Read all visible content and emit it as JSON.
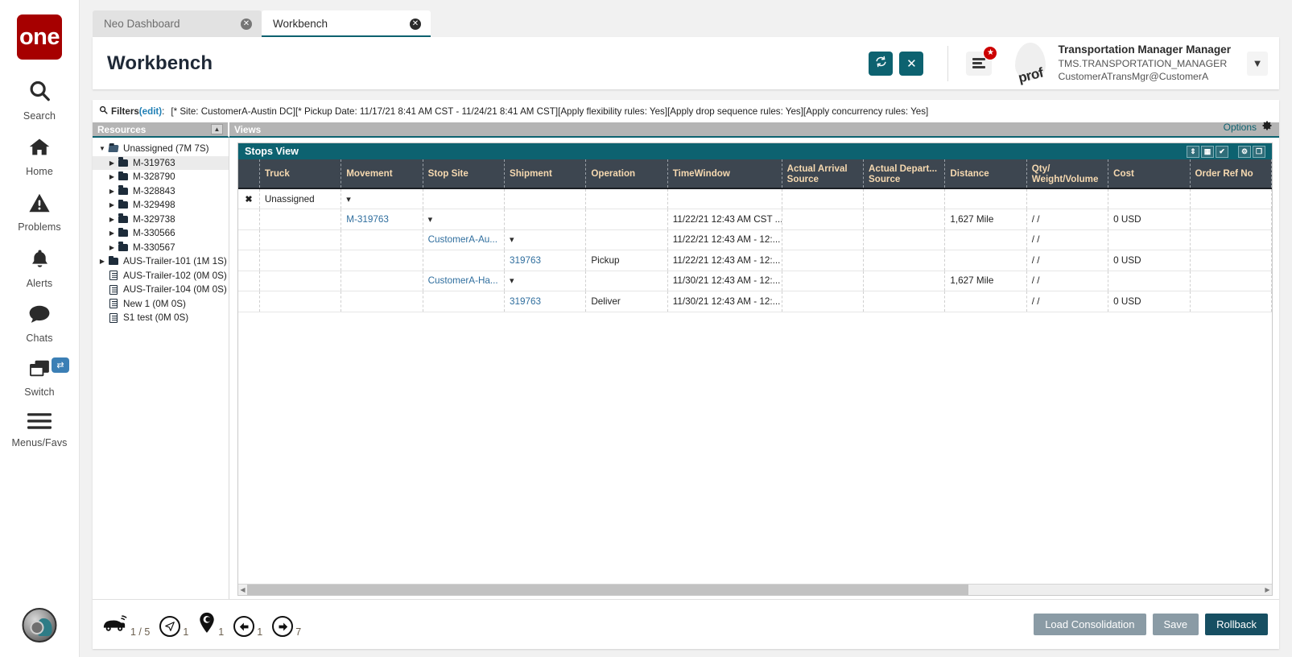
{
  "brand": {
    "logo_text": "one"
  },
  "rail": {
    "items": [
      {
        "label": "Search",
        "icon": "search-icon"
      },
      {
        "label": "Home",
        "icon": "home-icon"
      },
      {
        "label": "Problems",
        "icon": "warning-triangle-icon"
      },
      {
        "label": "Alerts",
        "icon": "bell-icon"
      },
      {
        "label": "Chats",
        "icon": "chat-bubble-icon"
      },
      {
        "label": "Switch",
        "icon": "windows-stack-icon",
        "badge_icon": "swap-arrows-icon"
      },
      {
        "label": "Menus/Favs",
        "icon": "hamburger-icon"
      }
    ]
  },
  "tabs": [
    {
      "label": "Neo Dashboard",
      "active": false
    },
    {
      "label": "Workbench",
      "active": true
    }
  ],
  "header": {
    "title": "Workbench",
    "refresh_icon": "refresh-icon",
    "close_icon": "close-x-icon",
    "menu_icon": "hamburger-menu-icon",
    "notification_badge": "★",
    "avatar_text": "prof",
    "user_name": "Transportation Manager Manager",
    "user_role": "TMS.TRANSPORTATION_MANAGER",
    "user_account": "CustomerATransMgr@CustomerA",
    "caret_icon": "chevron-down-icon"
  },
  "filters": {
    "icon": "search-icon",
    "label": "Filters",
    "edit_link": "(edit)",
    "colon": ":",
    "value": "[* Site: CustomerA-Austin DC][* Pickup Date: 11/17/21 8:41 AM CST - 11/24/21 8:41 AM CST][Apply flexibility rules: Yes][Apply drop sequence rules: Yes][Apply concurrency rules: Yes]"
  },
  "panels": {
    "resources_title": "Resources",
    "views_title": "Views",
    "collapse_icon": "chevron-up-icon",
    "options_label": "Options",
    "options_icon": "gear-icon"
  },
  "tree": [
    {
      "label": "Unassigned (7M 7S)",
      "indent": 0,
      "arrow": "▼",
      "icon": "folder-open-icon",
      "selected": false
    },
    {
      "label": "M-319763",
      "indent": 1,
      "arrow": "▶",
      "icon": "folder-icon",
      "selected": true
    },
    {
      "label": "M-328790",
      "indent": 1,
      "arrow": "▶",
      "icon": "folder-icon",
      "selected": false
    },
    {
      "label": "M-328843",
      "indent": 1,
      "arrow": "▶",
      "icon": "folder-icon",
      "selected": false
    },
    {
      "label": "M-329498",
      "indent": 1,
      "arrow": "▶",
      "icon": "folder-icon",
      "selected": false
    },
    {
      "label": "M-329738",
      "indent": 1,
      "arrow": "▶",
      "icon": "folder-icon",
      "selected": false
    },
    {
      "label": "M-330566",
      "indent": 1,
      "arrow": "▶",
      "icon": "folder-icon",
      "selected": false
    },
    {
      "label": "M-330567",
      "indent": 1,
      "arrow": "▶",
      "icon": "folder-icon",
      "selected": false
    },
    {
      "label": "AUS-Trailer-101 (1M 1S)",
      "indent": 0,
      "arrow": "▶",
      "icon": "folder-icon",
      "selected": false
    },
    {
      "label": "AUS-Trailer-102 (0M 0S)",
      "indent": 0,
      "arrow": "",
      "icon": "document-icon",
      "selected": false
    },
    {
      "label": "AUS-Trailer-104 (0M 0S)",
      "indent": 0,
      "arrow": "",
      "icon": "document-icon",
      "selected": false
    },
    {
      "label": "New 1 (0M 0S)",
      "indent": 0,
      "arrow": "",
      "icon": "document-icon",
      "selected": false
    },
    {
      "label": "S1 test (0M 0S)",
      "indent": 0,
      "arrow": "",
      "icon": "document-icon",
      "selected": false
    }
  ],
  "grid": {
    "title": "Stops View",
    "tools": [
      {
        "icon": "expand-collapse-icon",
        "glyph": "⇕"
      },
      {
        "icon": "table-grid-icon",
        "glyph": "▦"
      },
      {
        "icon": "checkmark-icon",
        "glyph": "✔"
      },
      {
        "icon": "gear-icon",
        "glyph": "⚙"
      },
      {
        "icon": "popout-window-icon",
        "glyph": "❐"
      }
    ],
    "columns": [
      "",
      "Truck",
      "Movement",
      "Stop Site",
      "Shipment",
      "Operation",
      "TimeWindow",
      "Actual Arrival Source",
      "Actual Depart... Source",
      "Distance",
      "Qty/ Weight/Volume",
      "Cost",
      "Order Ref No"
    ],
    "rows": [
      {
        "select": "✖",
        "truck": "Unassigned",
        "movement": "",
        "movement_dot": "▾",
        "stop_site": "",
        "stop_site_dot": "",
        "shipment": "",
        "shipment_dot": "",
        "operation": "",
        "timewindow": "",
        "arrival": "",
        "departure": "",
        "distance": "",
        "qty": "",
        "cost": "",
        "order_ref": ""
      },
      {
        "select": "",
        "truck": "",
        "movement": "M-319763",
        "movement_dot": "",
        "stop_site": "",
        "stop_site_dot": "▾",
        "shipment": "",
        "shipment_dot": "",
        "operation": "",
        "timewindow": "11/22/21 12:43 AM CST ...",
        "arrival": "",
        "departure": "",
        "distance": "1,627 Mile",
        "qty": "/ /",
        "cost": "0 USD",
        "order_ref": ""
      },
      {
        "select": "",
        "truck": "",
        "movement": "",
        "movement_dot": "",
        "stop_site": "CustomerA-Au...",
        "stop_site_dot": "",
        "shipment": "",
        "shipment_dot": "▾",
        "operation": "",
        "timewindow": "11/22/21 12:43 AM - 12:...",
        "arrival": "",
        "departure": "",
        "distance": "",
        "qty": "/ /",
        "cost": "",
        "order_ref": ""
      },
      {
        "select": "",
        "truck": "",
        "movement": "",
        "movement_dot": "",
        "stop_site": "",
        "stop_site_dot": "",
        "shipment": "319763",
        "shipment_dot": "",
        "operation": "Pickup",
        "timewindow": "11/22/21 12:43 AM - 12:...",
        "arrival": "",
        "departure": "",
        "distance": "",
        "qty": "/ /",
        "cost": "0 USD",
        "order_ref": ""
      },
      {
        "select": "",
        "truck": "",
        "movement": "",
        "movement_dot": "",
        "stop_site": "CustomerA-Ha...",
        "stop_site_dot": "",
        "shipment": "",
        "shipment_dot": "▾",
        "operation": "",
        "timewindow": "11/30/21 12:43 AM - 12:...",
        "arrival": "",
        "departure": "",
        "distance": "1,627 Mile",
        "qty": "/ /",
        "cost": "",
        "order_ref": ""
      },
      {
        "select": "",
        "truck": "",
        "movement": "",
        "movement_dot": "",
        "stop_site": "",
        "stop_site_dot": "",
        "shipment": "319763",
        "shipment_dot": "",
        "operation": "Deliver",
        "timewindow": "11/30/21 12:43 AM - 12:...",
        "arrival": "",
        "departure": "",
        "distance": "",
        "qty": "/ /",
        "cost": "0 USD",
        "order_ref": ""
      }
    ]
  },
  "footer": {
    "stats": [
      {
        "icon": "truck-icon",
        "value": "1 / 5"
      },
      {
        "icon": "navigation-arrow-icon",
        "value": "1"
      },
      {
        "icon": "map-pin-icon",
        "value": "1"
      },
      {
        "icon": "arrow-left-icon",
        "value": "1"
      },
      {
        "icon": "arrow-right-icon",
        "value": "7"
      }
    ],
    "buttons": [
      {
        "label": "Load Consolidation",
        "style": "grey"
      },
      {
        "label": "Save",
        "style": "grey"
      },
      {
        "label": "Rollback",
        "style": "dark"
      }
    ]
  },
  "colors": {
    "brand_red": "#a60000",
    "teal": "#0d6270",
    "header_dark": "#3d4650",
    "header_text": "#f6d9b0",
    "link_blue": "#2f6e9e"
  }
}
